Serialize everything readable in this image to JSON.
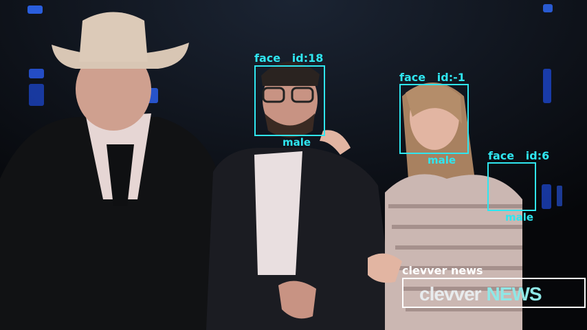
{
  "detections": [
    {
      "label": "face   id:18",
      "gender": "male"
    },
    {
      "label": "face   id:-1",
      "gender": "male"
    },
    {
      "label": "face   id:6",
      "gender": "male"
    }
  ],
  "logo": {
    "label": "clevver news",
    "wordmark_part1": "clevver",
    "wordmark_part2": "NEWS"
  },
  "colors": {
    "box": "#2fe6f0",
    "logo_box": "#ffffff",
    "background": "#07080b"
  }
}
